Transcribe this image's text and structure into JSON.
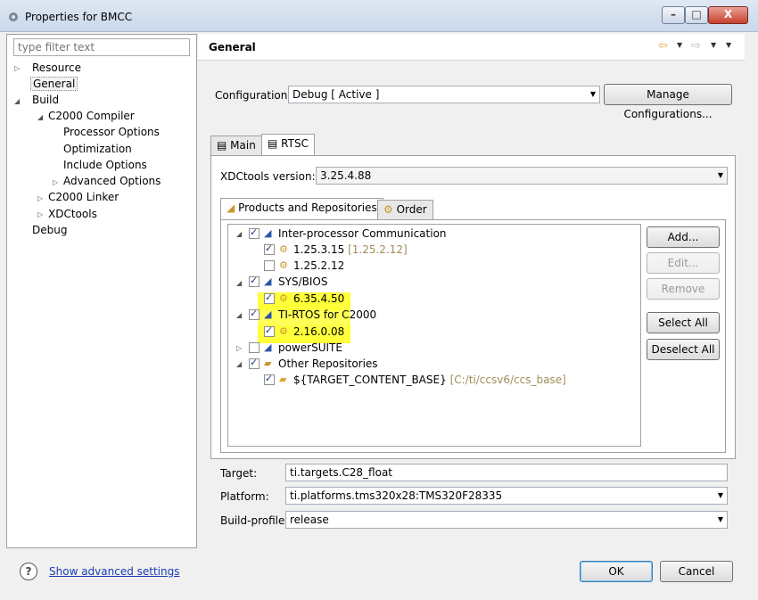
{
  "window": {
    "title": "Properties for BMCC",
    "minimize": "–",
    "maximize": "□",
    "close": "X"
  },
  "left": {
    "filter_placeholder": "type filter text",
    "tree": [
      {
        "label": "Resource"
      },
      {
        "label": "General"
      },
      {
        "label": "Build"
      },
      {
        "label": "C2000 Compiler"
      },
      {
        "label": "Processor Options"
      },
      {
        "label": "Optimization"
      },
      {
        "label": "Include Options"
      },
      {
        "label": "Advanced Options"
      },
      {
        "label": "C2000 Linker"
      },
      {
        "label": "XDCtools"
      },
      {
        "label": "Debug"
      }
    ]
  },
  "header": {
    "title": "General",
    "back_icon": "back-arrow-icon",
    "forward_icon": "forward-arrow-icon"
  },
  "configuration": {
    "label": "Configuration:",
    "value": "Debug  [ Active ]",
    "manage_button": "Manage Configurations..."
  },
  "tabs": [
    {
      "label": "Main"
    },
    {
      "label": "RTSC"
    }
  ],
  "rtsc": {
    "xdc_label": "XDCtools version:",
    "xdc_value": "3.25.4.88",
    "subtabs": [
      {
        "label": "Products and Repositories"
      },
      {
        "label": "Order"
      }
    ],
    "products": [
      {
        "label": "Inter-processor Communication",
        "checked": true
      },
      {
        "label": "1.25.3.15",
        "extra": "[1.25.2.12]",
        "checked": true
      },
      {
        "label": "1.25.2.12",
        "checked": false
      },
      {
        "label": "SYS/BIOS",
        "checked": true
      },
      {
        "label": "6.35.4.50",
        "checked": true
      },
      {
        "label": "TI-RTOS for C2000",
        "checked": true
      },
      {
        "label": "2.16.0.08",
        "checked": true
      },
      {
        "label": "powerSUITE",
        "checked": false
      },
      {
        "label": "Other Repositories",
        "checked": true
      },
      {
        "label": "${TARGET_CONTENT_BASE}",
        "extra": "[C:/ti/ccsv6/ccs_base]",
        "checked": true
      }
    ],
    "buttons": {
      "add": "Add...",
      "edit": "Edit...",
      "remove": "Remove",
      "select_all": "Select All",
      "deselect_all": "Deselect All"
    },
    "highlight_color": "#ffff3a"
  },
  "target": {
    "label": "Target:",
    "value": "ti.targets.C28_float"
  },
  "platform": {
    "label": "Platform:",
    "value": "ti.platforms.tms320x28:TMS320F28335"
  },
  "build_profile": {
    "label": "Build-profile:",
    "value": "release"
  },
  "footer": {
    "help": "?",
    "advanced_link": "Show advanced settings",
    "ok": "OK",
    "cancel": "Cancel"
  }
}
